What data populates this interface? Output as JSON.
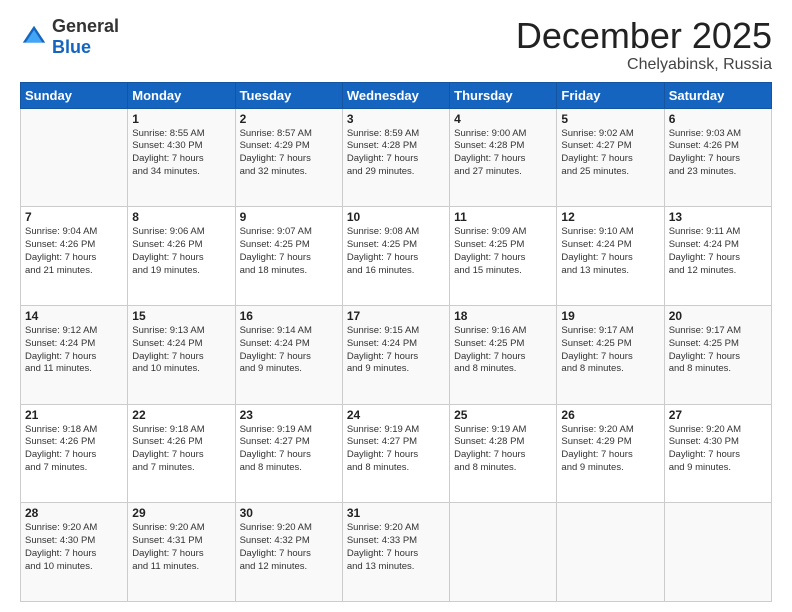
{
  "logo": {
    "general": "General",
    "blue": "Blue"
  },
  "header": {
    "month": "December 2025",
    "location": "Chelyabinsk, Russia"
  },
  "weekdays": [
    "Sunday",
    "Monday",
    "Tuesday",
    "Wednesday",
    "Thursday",
    "Friday",
    "Saturday"
  ],
  "weeks": [
    [
      {
        "day": "",
        "content": ""
      },
      {
        "day": "1",
        "content": "Sunrise: 8:55 AM\nSunset: 4:30 PM\nDaylight: 7 hours\nand 34 minutes."
      },
      {
        "day": "2",
        "content": "Sunrise: 8:57 AM\nSunset: 4:29 PM\nDaylight: 7 hours\nand 32 minutes."
      },
      {
        "day": "3",
        "content": "Sunrise: 8:59 AM\nSunset: 4:28 PM\nDaylight: 7 hours\nand 29 minutes."
      },
      {
        "day": "4",
        "content": "Sunrise: 9:00 AM\nSunset: 4:28 PM\nDaylight: 7 hours\nand 27 minutes."
      },
      {
        "day": "5",
        "content": "Sunrise: 9:02 AM\nSunset: 4:27 PM\nDaylight: 7 hours\nand 25 minutes."
      },
      {
        "day": "6",
        "content": "Sunrise: 9:03 AM\nSunset: 4:26 PM\nDaylight: 7 hours\nand 23 minutes."
      }
    ],
    [
      {
        "day": "7",
        "content": "Sunrise: 9:04 AM\nSunset: 4:26 PM\nDaylight: 7 hours\nand 21 minutes."
      },
      {
        "day": "8",
        "content": "Sunrise: 9:06 AM\nSunset: 4:26 PM\nDaylight: 7 hours\nand 19 minutes."
      },
      {
        "day": "9",
        "content": "Sunrise: 9:07 AM\nSunset: 4:25 PM\nDaylight: 7 hours\nand 18 minutes."
      },
      {
        "day": "10",
        "content": "Sunrise: 9:08 AM\nSunset: 4:25 PM\nDaylight: 7 hours\nand 16 minutes."
      },
      {
        "day": "11",
        "content": "Sunrise: 9:09 AM\nSunset: 4:25 PM\nDaylight: 7 hours\nand 15 minutes."
      },
      {
        "day": "12",
        "content": "Sunrise: 9:10 AM\nSunset: 4:24 PM\nDaylight: 7 hours\nand 13 minutes."
      },
      {
        "day": "13",
        "content": "Sunrise: 9:11 AM\nSunset: 4:24 PM\nDaylight: 7 hours\nand 12 minutes."
      }
    ],
    [
      {
        "day": "14",
        "content": "Sunrise: 9:12 AM\nSunset: 4:24 PM\nDaylight: 7 hours\nand 11 minutes."
      },
      {
        "day": "15",
        "content": "Sunrise: 9:13 AM\nSunset: 4:24 PM\nDaylight: 7 hours\nand 10 minutes."
      },
      {
        "day": "16",
        "content": "Sunrise: 9:14 AM\nSunset: 4:24 PM\nDaylight: 7 hours\nand 9 minutes."
      },
      {
        "day": "17",
        "content": "Sunrise: 9:15 AM\nSunset: 4:24 PM\nDaylight: 7 hours\nand 9 minutes."
      },
      {
        "day": "18",
        "content": "Sunrise: 9:16 AM\nSunset: 4:25 PM\nDaylight: 7 hours\nand 8 minutes."
      },
      {
        "day": "19",
        "content": "Sunrise: 9:17 AM\nSunset: 4:25 PM\nDaylight: 7 hours\nand 8 minutes."
      },
      {
        "day": "20",
        "content": "Sunrise: 9:17 AM\nSunset: 4:25 PM\nDaylight: 7 hours\nand 8 minutes."
      }
    ],
    [
      {
        "day": "21",
        "content": "Sunrise: 9:18 AM\nSunset: 4:26 PM\nDaylight: 7 hours\nand 7 minutes."
      },
      {
        "day": "22",
        "content": "Sunrise: 9:18 AM\nSunset: 4:26 PM\nDaylight: 7 hours\nand 7 minutes."
      },
      {
        "day": "23",
        "content": "Sunrise: 9:19 AM\nSunset: 4:27 PM\nDaylight: 7 hours\nand 8 minutes."
      },
      {
        "day": "24",
        "content": "Sunrise: 9:19 AM\nSunset: 4:27 PM\nDaylight: 7 hours\nand 8 minutes."
      },
      {
        "day": "25",
        "content": "Sunrise: 9:19 AM\nSunset: 4:28 PM\nDaylight: 7 hours\nand 8 minutes."
      },
      {
        "day": "26",
        "content": "Sunrise: 9:20 AM\nSunset: 4:29 PM\nDaylight: 7 hours\nand 9 minutes."
      },
      {
        "day": "27",
        "content": "Sunrise: 9:20 AM\nSunset: 4:30 PM\nDaylight: 7 hours\nand 9 minutes."
      }
    ],
    [
      {
        "day": "28",
        "content": "Sunrise: 9:20 AM\nSunset: 4:30 PM\nDaylight: 7 hours\nand 10 minutes."
      },
      {
        "day": "29",
        "content": "Sunrise: 9:20 AM\nSunset: 4:31 PM\nDaylight: 7 hours\nand 11 minutes."
      },
      {
        "day": "30",
        "content": "Sunrise: 9:20 AM\nSunset: 4:32 PM\nDaylight: 7 hours\nand 12 minutes."
      },
      {
        "day": "31",
        "content": "Sunrise: 9:20 AM\nSunset: 4:33 PM\nDaylight: 7 hours\nand 13 minutes."
      },
      {
        "day": "",
        "content": ""
      },
      {
        "day": "",
        "content": ""
      },
      {
        "day": "",
        "content": ""
      }
    ]
  ]
}
